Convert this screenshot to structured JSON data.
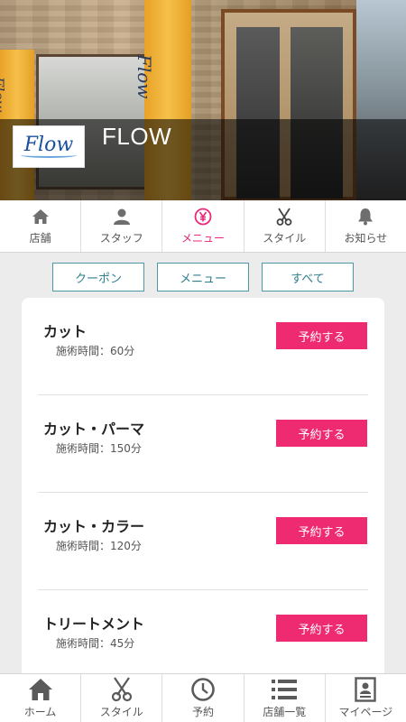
{
  "header": {
    "shop_name": "FLOW",
    "logo_text": "Flow"
  },
  "tabs": [
    {
      "label": "店舗",
      "icon": "home-icon",
      "active": false
    },
    {
      "label": "スタッフ",
      "icon": "person-icon",
      "active": false
    },
    {
      "label": "メニュー",
      "icon": "yen-icon",
      "active": true
    },
    {
      "label": "スタイル",
      "icon": "scissors-icon",
      "active": false
    },
    {
      "label": "お知らせ",
      "icon": "bell-icon",
      "active": false
    }
  ],
  "filters": [
    "クーポン",
    "メニュー",
    "すべて"
  ],
  "menu_items": [
    {
      "name": "カット",
      "duration": "施術時間：60分",
      "button": "予約する"
    },
    {
      "name": "カット・パーマ",
      "duration": "施術時間：150分",
      "button": "予約する"
    },
    {
      "name": "カット・カラー",
      "duration": "施術時間：120分",
      "button": "予約する"
    },
    {
      "name": "トリートメント",
      "duration": "施術時間：45分",
      "button": "予約する"
    }
  ],
  "bottom_nav": [
    {
      "label": "ホーム",
      "icon": "home-icon"
    },
    {
      "label": "スタイル",
      "icon": "scissors-icon"
    },
    {
      "label": "予約",
      "icon": "clock-icon"
    },
    {
      "label": "店舗一覧",
      "icon": "list-icon"
    },
    {
      "label": "マイページ",
      "icon": "id-card-icon"
    }
  ],
  "colors": {
    "accent_pink": "#ee2a70",
    "filter_teal": "#2f7e8d",
    "active_tab": "#e8277a"
  }
}
